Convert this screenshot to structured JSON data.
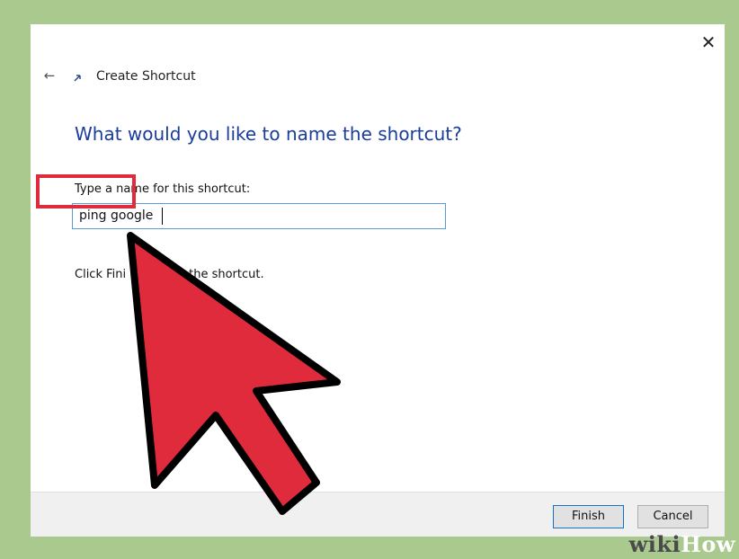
{
  "dialog": {
    "title": "Create Shortcut",
    "heading": "What would you like to name the shortcut?",
    "field_label": "Type a name for this shortcut:",
    "field_value": "ping google",
    "instruction_start": "Click Fini",
    "instruction_end": "the shortcut.",
    "close_icon": "close-icon",
    "back_icon": "back-arrow-icon"
  },
  "footer": {
    "finish_label": "Finish",
    "cancel_label": "Cancel"
  },
  "watermark": {
    "wiki": "wiki",
    "how": "How"
  },
  "colors": {
    "heading": "#1a3d9c",
    "annotation_red": "#e02b3d",
    "input_border": "#5a9bd5",
    "page_background": "#a9c98f"
  }
}
